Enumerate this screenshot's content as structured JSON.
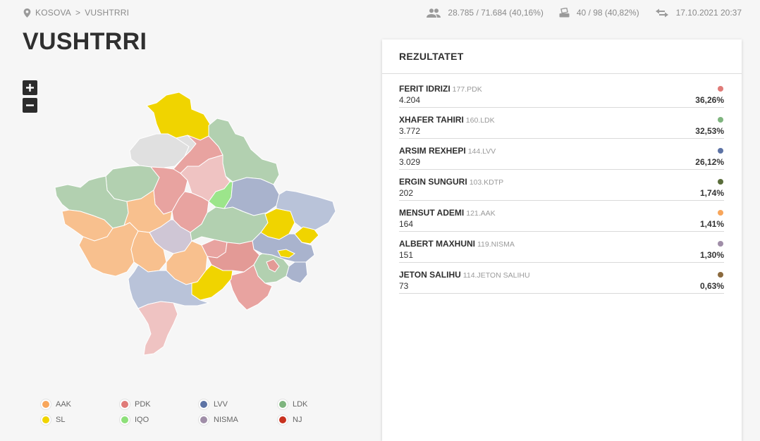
{
  "breadcrumb": {
    "country": "KOSOVA",
    "separator": ">",
    "municipality": "VUSHTRRI"
  },
  "stats": {
    "voters": "28.785 / 71.684 (40,16%)",
    "stations": "40 / 98 (40,82%)",
    "updated": "17.10.2021 20:37"
  },
  "title": "VUSHTRRI",
  "zoom": {
    "in": "+",
    "out": "−"
  },
  "legend": [
    {
      "label": "AAK",
      "color": "#f8a65b"
    },
    {
      "label": "PDK",
      "color": "#e07b78"
    },
    {
      "label": "LVV",
      "color": "#5d73a5"
    },
    {
      "label": "LDK",
      "color": "#7fb57f"
    },
    {
      "label": "SL",
      "color": "#f0d400"
    },
    {
      "label": "IQO",
      "color": "#8ee07a"
    },
    {
      "label": "NISMA",
      "color": "#a08ea8"
    },
    {
      "label": "NJ",
      "color": "#c8321f"
    }
  ],
  "results": {
    "heading": "REZULTATET",
    "candidates": [
      {
        "name": "FERIT IDRIZI",
        "party": "177.PDK",
        "votes": "4.204",
        "pct": "36,26%",
        "color": "#e07b78"
      },
      {
        "name": "XHAFER TAHIRI",
        "party": "160.LDK",
        "votes": "3.772",
        "pct": "32,53%",
        "color": "#7fb57f"
      },
      {
        "name": "ARSIM REXHEPI",
        "party": "144.LVV",
        "votes": "3.029",
        "pct": "26,12%",
        "color": "#5d73a5"
      },
      {
        "name": "ERGIN SUNGURI",
        "party": "103.KDTP",
        "votes": "202",
        "pct": "1,74%",
        "color": "#5a6d3b"
      },
      {
        "name": "MENSUT ADEMI",
        "party": "121.AAK",
        "votes": "164",
        "pct": "1,41%",
        "color": "#f8a65b"
      },
      {
        "name": "ALBERT MAXHUNI",
        "party": "119.NISMA",
        "votes": "151",
        "pct": "1,30%",
        "color": "#a08ea8"
      },
      {
        "name": "JETON SALIHU",
        "party": "114.JETON SALIHU",
        "votes": "73",
        "pct": "0,63%",
        "color": "#8b6a3e"
      }
    ]
  },
  "map_colors": {
    "aak": "#f8c08e",
    "pdk": "#e8a3a0",
    "lvv": "#a9b3cd",
    "ldk": "#b2d0b0",
    "sl": "#f0d400",
    "iqo": "#9ce58b",
    "nisma": "#cfc6d5",
    "grey": "#e0e0e0",
    "pdk_light": "#efc3c2",
    "pdk_strong": "#e39a96",
    "lvv_light": "#b9c3d9",
    "selected_outline": "#d4a86a"
  }
}
